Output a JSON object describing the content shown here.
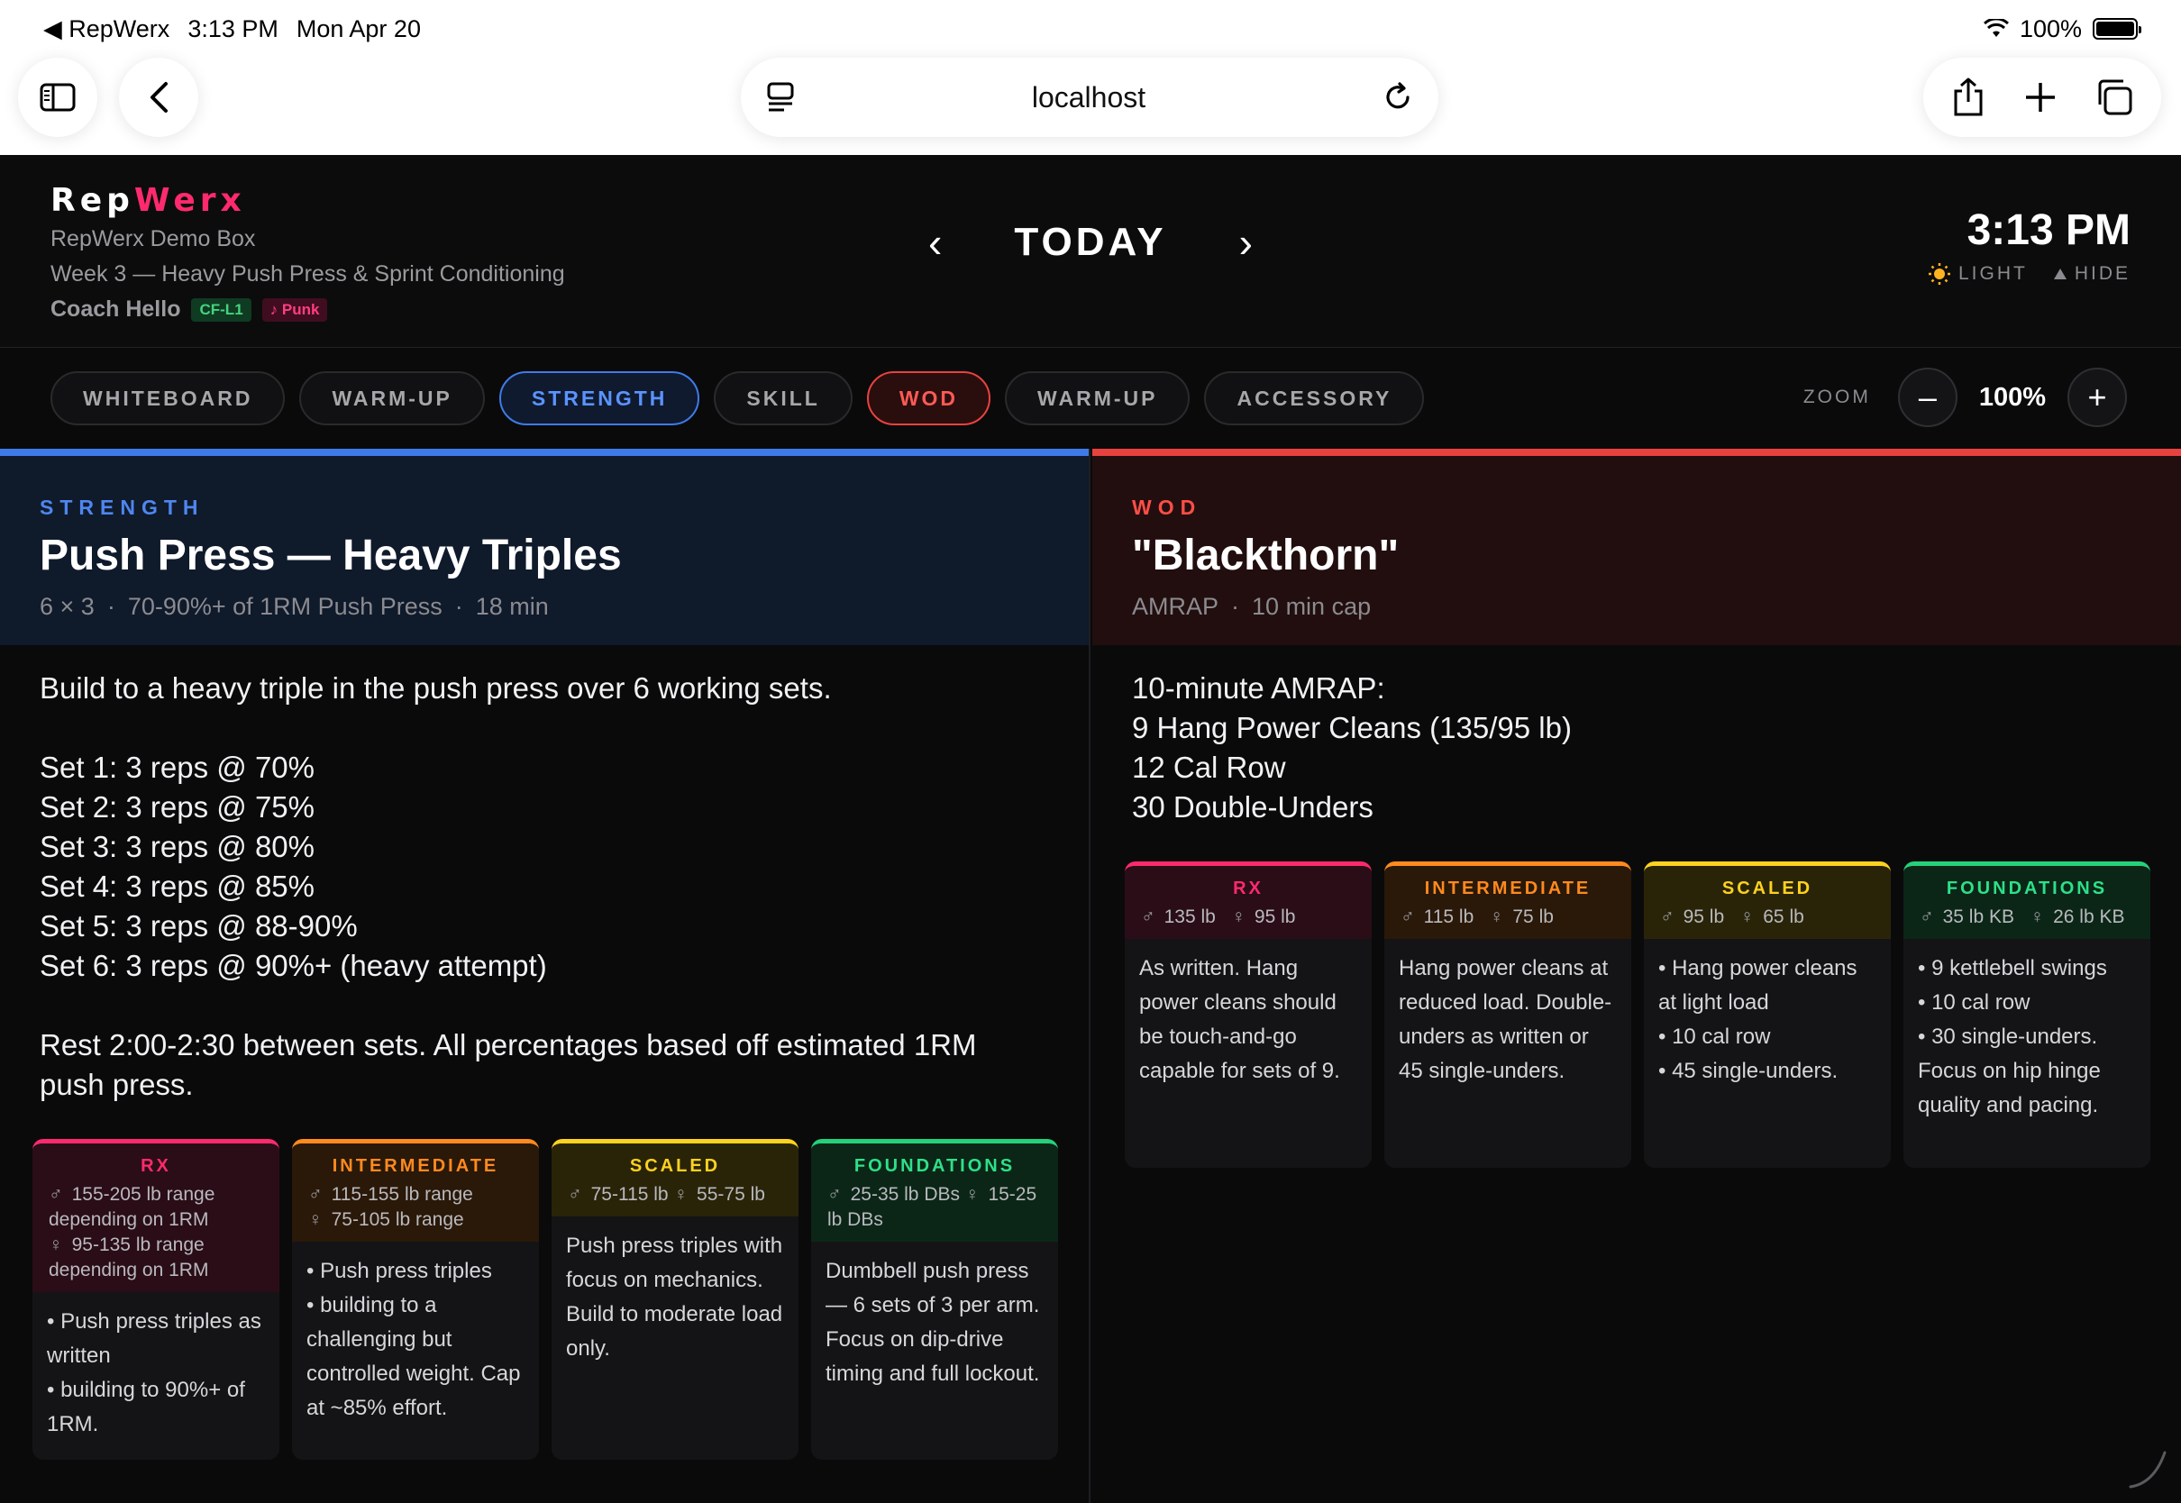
{
  "status": {
    "back_app": "RepWerx",
    "time": "3:13 PM",
    "date": "Mon Apr 20",
    "battery": "100%"
  },
  "browser": {
    "url": "localhost"
  },
  "header": {
    "logo_a": "Rep",
    "logo_b": "Werx",
    "box_name": "RepWerx Demo Box",
    "week": "Week 3 — Heavy Push Press & Sprint Conditioning",
    "coach": "Coach Hello",
    "badge_cert": "CF-L1",
    "badge_music": "♪ Punk",
    "day": "TODAY",
    "prev": "‹",
    "next": "›",
    "clock": "3:13 PM",
    "light": "LIGHT",
    "hide": "HIDE"
  },
  "tabs": [
    "WHITEBOARD",
    "WARM-UP",
    "STRENGTH",
    "SKILL",
    "WOD",
    "WARM-UP",
    "ACCESSORY"
  ],
  "zoom": {
    "label": "ZOOM",
    "minus": "–",
    "value": "100%",
    "plus": "+"
  },
  "strength": {
    "kicker": "STRENGTH",
    "title": "Push Press — Heavy Triples",
    "sub": [
      "6 × 3",
      "·",
      "70-90%+ of 1RM Push Press",
      "·",
      "18 min"
    ],
    "desc": "Build to a heavy triple in the push press over 6 working sets.\n\nSet 1: 3 reps @ 70%\nSet 2: 3 reps @ 75%\nSet 3: 3 reps @ 80%\nSet 4: 3 reps @ 85%\nSet 5: 3 reps @ 88-90%\nSet 6: 3 reps @ 90%+ (heavy attempt)\n\nRest 2:00-2:30 between sets. All percentages based off estimated 1RM push press.",
    "levels": [
      {
        "name": "RX",
        "male": "155-205 lb range depending on 1RM",
        "female": "95-135 lb range depending on 1RM",
        "body": "• Push press triples as written\n• building to 90%+ of 1RM."
      },
      {
        "name": "INTERMEDIATE",
        "male": "115-155 lb range",
        "female": "75-105 lb range",
        "body": "• Push press triples\n• building to a challenging but controlled weight. Cap at ~85% effort."
      },
      {
        "name": "SCALED",
        "male": "75-115 lb",
        "female": "55-75 lb",
        "body": "Push press triples with focus on mechanics. Build to moderate load only."
      },
      {
        "name": "FOUNDATIONS",
        "male": "25-35 lb DBs",
        "female": "15-25 lb DBs",
        "body": "Dumbbell push press — 6 sets of 3 per arm. Focus on dip-drive timing and full lockout."
      }
    ]
  },
  "wod": {
    "kicker": "WOD",
    "title": "\"Blackthorn\"",
    "sub": [
      "AMRAP",
      "·",
      "10 min cap"
    ],
    "desc": "10-minute AMRAP:\n9 Hang Power Cleans (135/95 lb)\n12 Cal Row\n30 Double-Unders",
    "levels": [
      {
        "name": "RX",
        "male": "135 lb",
        "female": "95 lb",
        "body": "As written. Hang power cleans should be touch-and-go capable for sets of 9."
      },
      {
        "name": "INTERMEDIATE",
        "male": "115 lb",
        "female": "75 lb",
        "body": "Hang power cleans at reduced load. Double-unders as written or 45 single-unders."
      },
      {
        "name": "SCALED",
        "male": "95 lb",
        "female": "65 lb",
        "body": "• Hang power cleans at light load\n• 10 cal row\n• 45 single-unders."
      },
      {
        "name": "FOUNDATIONS",
        "male": "35 lb KB",
        "female": "26 lb KB",
        "body": "• 9 kettlebell swings\n• 10 cal row\n• 30 single-unders. Focus on hip hinge quality and pacing."
      }
    ]
  },
  "symbols": {
    "male": "♂",
    "female": "♀"
  }
}
